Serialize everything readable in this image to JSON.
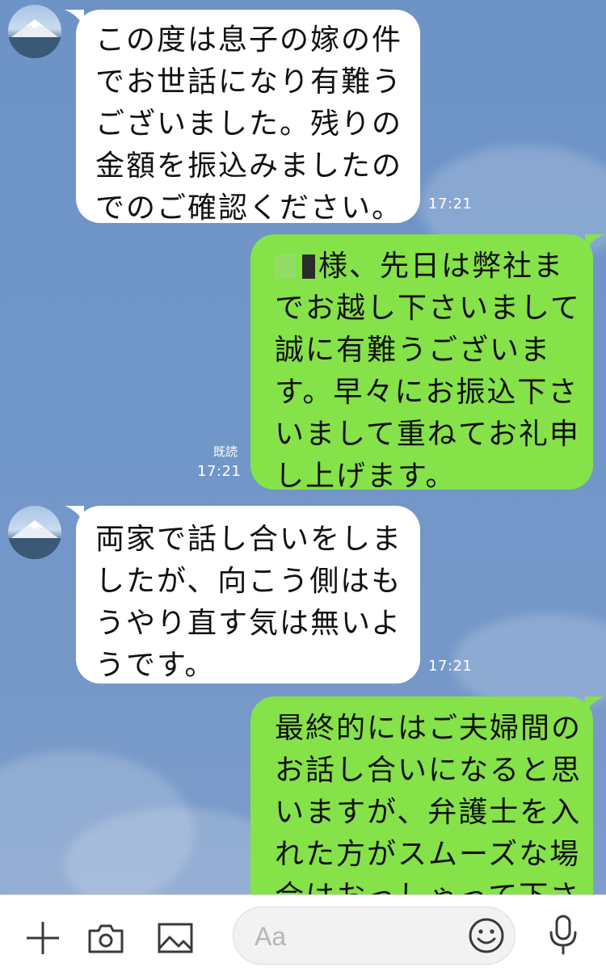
{
  "messages": [
    {
      "side": "in",
      "lines": [
        "この度は息子の嫁の件",
        "でお世話になり有難う",
        "ございました。残りの",
        "金額を振込みましたの",
        "でのご確認ください。"
      ],
      "time": "17:21"
    },
    {
      "side": "out",
      "lines": [
        "様、先日は弊社ま",
        "でお越し下さいまして",
        "誠に有難うございま",
        "す。早々にお振込下さ",
        "いまして重ねてお礼申",
        "し上げます。"
      ],
      "read": "既読",
      "time": "17:21"
    },
    {
      "side": "in",
      "lines": [
        "両家で話し合いをしま",
        "したが、向こう側はも",
        "うやり直す気は無いよ",
        "うです。"
      ],
      "time": "17:21"
    },
    {
      "side": "out",
      "lines": [
        "最終的にはご夫婦間の",
        "お話し合いになると思",
        "いますが、弁護士を入",
        "れた方がスムーズな場",
        "合はおっしゃって下さ"
      ]
    }
  ],
  "composer": {
    "placeholder": "Aa",
    "icons": [
      "plus-icon",
      "camera-icon",
      "image-icon",
      "emoji-icon",
      "microphone-icon"
    ]
  },
  "colors": {
    "outgoing_bubble": "#85e249",
    "incoming_bubble": "#ffffff",
    "chat_background": "#7096c8"
  }
}
